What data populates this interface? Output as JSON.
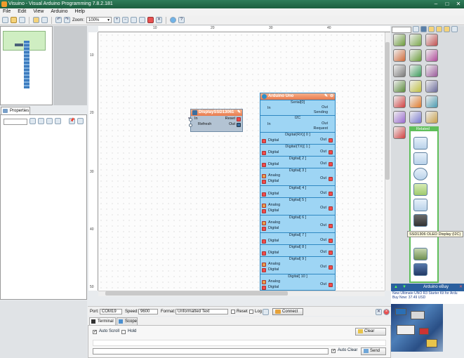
{
  "window": {
    "title": "Visuino - Visual Arduino Programming 7.8.2.181",
    "controls": [
      "–",
      "□",
      "✕"
    ]
  },
  "menu": [
    "File",
    "Edit",
    "View",
    "Arduino",
    "Help"
  ],
  "toolbar": {
    "zoom_label": "Zoom:",
    "zoom_value": "100%"
  },
  "properties": {
    "tab_label": "Properties"
  },
  "rulers": {
    "top": [
      "10",
      "20",
      "30",
      "40"
    ],
    "left": [
      "10",
      "20",
      "30",
      "40",
      "50"
    ]
  },
  "display_component": {
    "title": "DisplaySSD13061",
    "inputs": [
      "In",
      "Refresh"
    ],
    "outputs": [
      "Reset",
      "Out"
    ]
  },
  "arduino_component": {
    "title": "Arduino Uno",
    "serial_title": "Serial[0]",
    "serial_in": "In",
    "serial_outs": [
      "Out",
      "Sending"
    ],
    "i2c_title": "I2C",
    "i2c_in": "In",
    "i2c_outs": [
      "Out",
      "Request"
    ],
    "pins": [
      {
        "title": "Digital(RX)[ 0 ]",
        "analog": false
      },
      {
        "title": "Digital(TX)[ 1 ]",
        "analog": false
      },
      {
        "title": "Digital[ 2 ]",
        "analog": false
      },
      {
        "title": "Digital[ 3 ]",
        "analog": true
      },
      {
        "title": "Digital[ 4 ]",
        "analog": false
      },
      {
        "title": "Digital[ 5 ]",
        "analog": true
      },
      {
        "title": "Digital[ 6 ]",
        "analog": true
      },
      {
        "title": "Digital[ 7 ]",
        "analog": false
      },
      {
        "title": "Digital[ 8 ]",
        "analog": false
      },
      {
        "title": "Digital[ 9 ]",
        "analog": true
      },
      {
        "title": "Digital[ 10 ]",
        "analog": true
      }
    ],
    "digital_label": "Digital",
    "analog_label": "Analog",
    "out_label": "Out"
  },
  "palette": {
    "related_title": "Related",
    "tooltip": "SSD1306 OLED Display (I2C)"
  },
  "ad": {
    "title": "Arduino eBay",
    "line1": "New Ultimate UNO R3 Starter Kit for Ardu",
    "line2": "Buy Now: 37.49 USD"
  },
  "serial": {
    "port_label": "Port:",
    "port_value": "COM19",
    "speed_label": "Speed:",
    "speed_value": "9600",
    "format_label": "Format:",
    "format_value": "Unformatted Text",
    "reset_label": "Reset",
    "log_label": "Log",
    "connect_label": "Connect"
  },
  "bottom_tabs": [
    "Terminal",
    "Scope"
  ],
  "terminal": {
    "auto_scroll_label": "Auto Scroll",
    "auto_scroll_checked": true,
    "hold_label": "Hold",
    "hold_checked": false,
    "clear_label": "Clear",
    "auto_clear_label": "Auto Clear",
    "auto_clear_checked": true,
    "send_label": "Send"
  },
  "colors": {
    "title_bar": "#1b5e3f",
    "arduino_body": "#59b7ea",
    "component_header": "#e97a4c",
    "related_border": "#5fbf5a"
  }
}
